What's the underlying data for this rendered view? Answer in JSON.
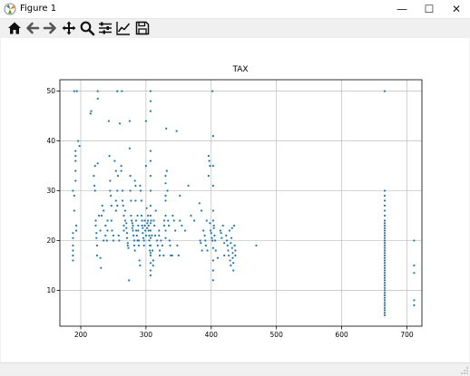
{
  "window": {
    "title": "Figure 1",
    "minimize": "—",
    "maximize": "☐",
    "close": "✕"
  },
  "toolbar": {
    "buttons": [
      {
        "name": "home-icon"
      },
      {
        "name": "back-arrow-icon"
      },
      {
        "name": "forward-arrow-icon"
      },
      {
        "name": "pan-icon"
      },
      {
        "name": "zoom-icon"
      },
      {
        "name": "configure-subplots-icon"
      },
      {
        "name": "edit-axis-icon"
      },
      {
        "name": "save-icon"
      }
    ]
  },
  "colors": {
    "series": "#1f77b4",
    "grid": "#b0b0b0",
    "axis": "#000000"
  },
  "chart_data": {
    "type": "scatter",
    "title": "TAX",
    "xlabel": "",
    "ylabel": "",
    "xlim": [
      168,
      723
    ],
    "ylim": [
      2.8,
      52.3
    ],
    "xticks": [
      200,
      300,
      400,
      500,
      600,
      700
    ],
    "yticks": [
      10,
      20,
      30,
      40,
      50
    ],
    "grid": true,
    "series": [
      {
        "points": [
          [
            188,
            30
          ],
          [
            188,
            21.5
          ],
          [
            188,
            20.5
          ],
          [
            188,
            19
          ],
          [
            188,
            18
          ],
          [
            188,
            17
          ],
          [
            188,
            16
          ],
          [
            190,
            50
          ],
          [
            190,
            29
          ],
          [
            190,
            26
          ],
          [
            192,
            38
          ],
          [
            192,
            37
          ],
          [
            192,
            36
          ],
          [
            192,
            34
          ],
          [
            192,
            32
          ],
          [
            193,
            23
          ],
          [
            193,
            22
          ],
          [
            194,
            50
          ],
          [
            196,
            40
          ],
          [
            198,
            39
          ],
          [
            215,
            45.5
          ],
          [
            216,
            46
          ],
          [
            220,
            33
          ],
          [
            221,
            31
          ],
          [
            222,
            35
          ],
          [
            222,
            30
          ],
          [
            223,
            24
          ],
          [
            223,
            23
          ],
          [
            224,
            21.5
          ],
          [
            224,
            20.5
          ],
          [
            225,
            19
          ],
          [
            225,
            17
          ],
          [
            226,
            50
          ],
          [
            226,
            35.5
          ],
          [
            226,
            48.5
          ],
          [
            228,
            25
          ],
          [
            230,
            22
          ],
          [
            230,
            16.5
          ],
          [
            231,
            14.5
          ],
          [
            232,
            25
          ],
          [
            233,
            27
          ],
          [
            235,
            26
          ],
          [
            235,
            20
          ],
          [
            238,
            23
          ],
          [
            238,
            21
          ],
          [
            240,
            20
          ],
          [
            241,
            22
          ],
          [
            241,
            24
          ],
          [
            243,
            44
          ],
          [
            244,
            37
          ],
          [
            245,
            32
          ],
          [
            245,
            30
          ],
          [
            246,
            29
          ],
          [
            247,
            27
          ],
          [
            247,
            24
          ],
          [
            248,
            22
          ],
          [
            250,
            21
          ],
          [
            250,
            20
          ],
          [
            252,
            36
          ],
          [
            254,
            28
          ],
          [
            254,
            26
          ],
          [
            254,
            34
          ],
          [
            256,
            50
          ],
          [
            256,
            30
          ],
          [
            256,
            27
          ],
          [
            257,
            33
          ],
          [
            258,
            21
          ],
          [
            259,
            20
          ],
          [
            260,
            43.5
          ],
          [
            262,
            35
          ],
          [
            262,
            34
          ],
          [
            263,
            50
          ],
          [
            264,
            30
          ],
          [
            264,
            28
          ],
          [
            265,
            27
          ],
          [
            266,
            25
          ],
          [
            266,
            23
          ],
          [
            266,
            22
          ],
          [
            268,
            26
          ],
          [
            268,
            24
          ],
          [
            270,
            23.5
          ],
          [
            270,
            22.5
          ],
          [
            271,
            21.5
          ],
          [
            271,
            20.5
          ],
          [
            272,
            19.5
          ],
          [
            272,
            19
          ],
          [
            273,
            18.5
          ],
          [
            274,
            12
          ],
          [
            275,
            44
          ],
          [
            275,
            38.5
          ],
          [
            276,
            33
          ],
          [
            276,
            30
          ],
          [
            277,
            28
          ],
          [
            277,
            25
          ],
          [
            278,
            24
          ],
          [
            279,
            23.5
          ],
          [
            279,
            22.5
          ],
          [
            280,
            23
          ],
          [
            280,
            22
          ],
          [
            281,
            21
          ],
          [
            282,
            20
          ],
          [
            282,
            19
          ],
          [
            283,
            18
          ],
          [
            283,
            32
          ],
          [
            284,
            31
          ],
          [
            284,
            28
          ],
          [
            285,
            24
          ],
          [
            285,
            22
          ],
          [
            286,
            21
          ],
          [
            287,
            20
          ],
          [
            287,
            25
          ],
          [
            288,
            23
          ],
          [
            288,
            22
          ],
          [
            289,
            20
          ],
          [
            289,
            19
          ],
          [
            290,
            16
          ],
          [
            291,
            15
          ],
          [
            291,
            31
          ],
          [
            292,
            30
          ],
          [
            293,
            28
          ],
          [
            293,
            25
          ],
          [
            294,
            24
          ],
          [
            294,
            23
          ],
          [
            295,
            22.5
          ],
          [
            295,
            21.5
          ],
          [
            296,
            20.5
          ],
          [
            297,
            20
          ],
          [
            297,
            19
          ],
          [
            298,
            23
          ],
          [
            298,
            24
          ],
          [
            299,
            22
          ],
          [
            300,
            21
          ],
          [
            300,
            35
          ],
          [
            300,
            44
          ],
          [
            301,
            26.5
          ],
          [
            302,
            23.5
          ],
          [
            302,
            22.5
          ],
          [
            303,
            25
          ],
          [
            303,
            24
          ],
          [
            304,
            23
          ],
          [
            304,
            22
          ],
          [
            305,
            21
          ],
          [
            305,
            20
          ],
          [
            306,
            19
          ],
          [
            306,
            18
          ],
          [
            307,
            17.5
          ],
          [
            307,
            50
          ],
          [
            307,
            48
          ],
          [
            307,
            46
          ],
          [
            307,
            38
          ],
          [
            307,
            36
          ],
          [
            307,
            33
          ],
          [
            307,
            30
          ],
          [
            307,
            27
          ],
          [
            307,
            25
          ],
          [
            307,
            23.5
          ],
          [
            307,
            22
          ],
          [
            307,
            20.5
          ],
          [
            307,
            19
          ],
          [
            307,
            17
          ],
          [
            307,
            15.5
          ],
          [
            307,
            14
          ],
          [
            307,
            13
          ],
          [
            308,
            24
          ],
          [
            309,
            21
          ],
          [
            310,
            18
          ],
          [
            311,
            16
          ],
          [
            311,
            15
          ],
          [
            312,
            24
          ],
          [
            313,
            23
          ],
          [
            314,
            21
          ],
          [
            315,
            26
          ],
          [
            317,
            20
          ],
          [
            318,
            19
          ],
          [
            320,
            22
          ],
          [
            320,
            21
          ],
          [
            321,
            18
          ],
          [
            321,
            17
          ],
          [
            323,
            20
          ],
          [
            325,
            19
          ],
          [
            327,
            17
          ],
          [
            328,
            24
          ],
          [
            328,
            23
          ],
          [
            330,
            33
          ],
          [
            330,
            31.5
          ],
          [
            330,
            29
          ],
          [
            330,
            28
          ],
          [
            330,
            25
          ],
          [
            330,
            22
          ],
          [
            330,
            20.5
          ],
          [
            331,
            42.5
          ],
          [
            332,
            34
          ],
          [
            333,
            30
          ],
          [
            334,
            24
          ],
          [
            335,
            23
          ],
          [
            336,
            20
          ],
          [
            337,
            19
          ],
          [
            338,
            17
          ],
          [
            340,
            17
          ],
          [
            341,
            25
          ],
          [
            343,
            24
          ],
          [
            345,
            22
          ],
          [
            347,
            42
          ],
          [
            348,
            19
          ],
          [
            350,
            17
          ],
          [
            352,
            24
          ],
          [
            352,
            29
          ],
          [
            355,
            23
          ],
          [
            360,
            22
          ],
          [
            365,
            31
          ],
          [
            369,
            25
          ],
          [
            374,
            24
          ],
          [
            382,
            27.5
          ],
          [
            383,
            20
          ],
          [
            384,
            19.5
          ],
          [
            385,
            26
          ],
          [
            386,
            18
          ],
          [
            388,
            22
          ],
          [
            390,
            21
          ],
          [
            391,
            20
          ],
          [
            392,
            19
          ],
          [
            393,
            24
          ],
          [
            394,
            18
          ],
          [
            396,
            37
          ],
          [
            396,
            33
          ],
          [
            397,
            36
          ],
          [
            398,
            35
          ],
          [
            398,
            23.5
          ],
          [
            399,
            22
          ],
          [
            400,
            21.5
          ],
          [
            401,
            20.5
          ],
          [
            402,
            20
          ],
          [
            402,
            50
          ],
          [
            403,
            41
          ],
          [
            403,
            35
          ],
          [
            403,
            31
          ],
          [
            403,
            26
          ],
          [
            403,
            24
          ],
          [
            403,
            18.5
          ],
          [
            403,
            16
          ],
          [
            403,
            14
          ],
          [
            403,
            12
          ],
          [
            404,
            23
          ],
          [
            404,
            22.5
          ],
          [
            405,
            21
          ],
          [
            406,
            20
          ],
          [
            407,
            18
          ],
          [
            410,
            16.5
          ],
          [
            414,
            22
          ],
          [
            415,
            21.5
          ],
          [
            416,
            20.5
          ],
          [
            418,
            23
          ],
          [
            420,
            19.5
          ],
          [
            420,
            17
          ],
          [
            423,
            21
          ],
          [
            424,
            20
          ],
          [
            425,
            19
          ],
          [
            426,
            18
          ],
          [
            427,
            17
          ],
          [
            428,
            22
          ],
          [
            429,
            16
          ],
          [
            430,
            19.5
          ],
          [
            430,
            15
          ],
          [
            431,
            20.5
          ],
          [
            432,
            18.5
          ],
          [
            432,
            22.5
          ],
          [
            433,
            17.5
          ],
          [
            433,
            16.5
          ],
          [
            434,
            15.5
          ],
          [
            434,
            14
          ],
          [
            435,
            23
          ],
          [
            436,
            19
          ],
          [
            437,
            18
          ],
          [
            437,
            17
          ],
          [
            469,
            19
          ],
          [
            666,
            50
          ],
          [
            666,
            30
          ],
          [
            666,
            29
          ],
          [
            666,
            28
          ],
          [
            666,
            27
          ],
          [
            666,
            26
          ],
          [
            666,
            25
          ],
          [
            666,
            24
          ],
          [
            666,
            23.5
          ],
          [
            666,
            23
          ],
          [
            666,
            22.5
          ],
          [
            666,
            22
          ],
          [
            666,
            21.5
          ],
          [
            666,
            21
          ],
          [
            666,
            20.5
          ],
          [
            666,
            20
          ],
          [
            666,
            19.5
          ],
          [
            666,
            19
          ],
          [
            666,
            18.5
          ],
          [
            666,
            18
          ],
          [
            666,
            17.5
          ],
          [
            666,
            17
          ],
          [
            666,
            16.5
          ],
          [
            666,
            16
          ],
          [
            666,
            15.5
          ],
          [
            666,
            15
          ],
          [
            666,
            14.5
          ],
          [
            666,
            14
          ],
          [
            666,
            13.5
          ],
          [
            666,
            13
          ],
          [
            666,
            12.5
          ],
          [
            666,
            12
          ],
          [
            666,
            11.5
          ],
          [
            666,
            11
          ],
          [
            666,
            10.5
          ],
          [
            666,
            10
          ],
          [
            666,
            9.5
          ],
          [
            666,
            9
          ],
          [
            666,
            8.5
          ],
          [
            666,
            8
          ],
          [
            666,
            7.5
          ],
          [
            666,
            7
          ],
          [
            666,
            6.5
          ],
          [
            666,
            6
          ],
          [
            666,
            5.5
          ],
          [
            666,
            5
          ],
          [
            711,
            20
          ],
          [
            711,
            15
          ],
          [
            711,
            13.5
          ],
          [
            711,
            8
          ],
          [
            711,
            7
          ]
        ]
      }
    ]
  }
}
